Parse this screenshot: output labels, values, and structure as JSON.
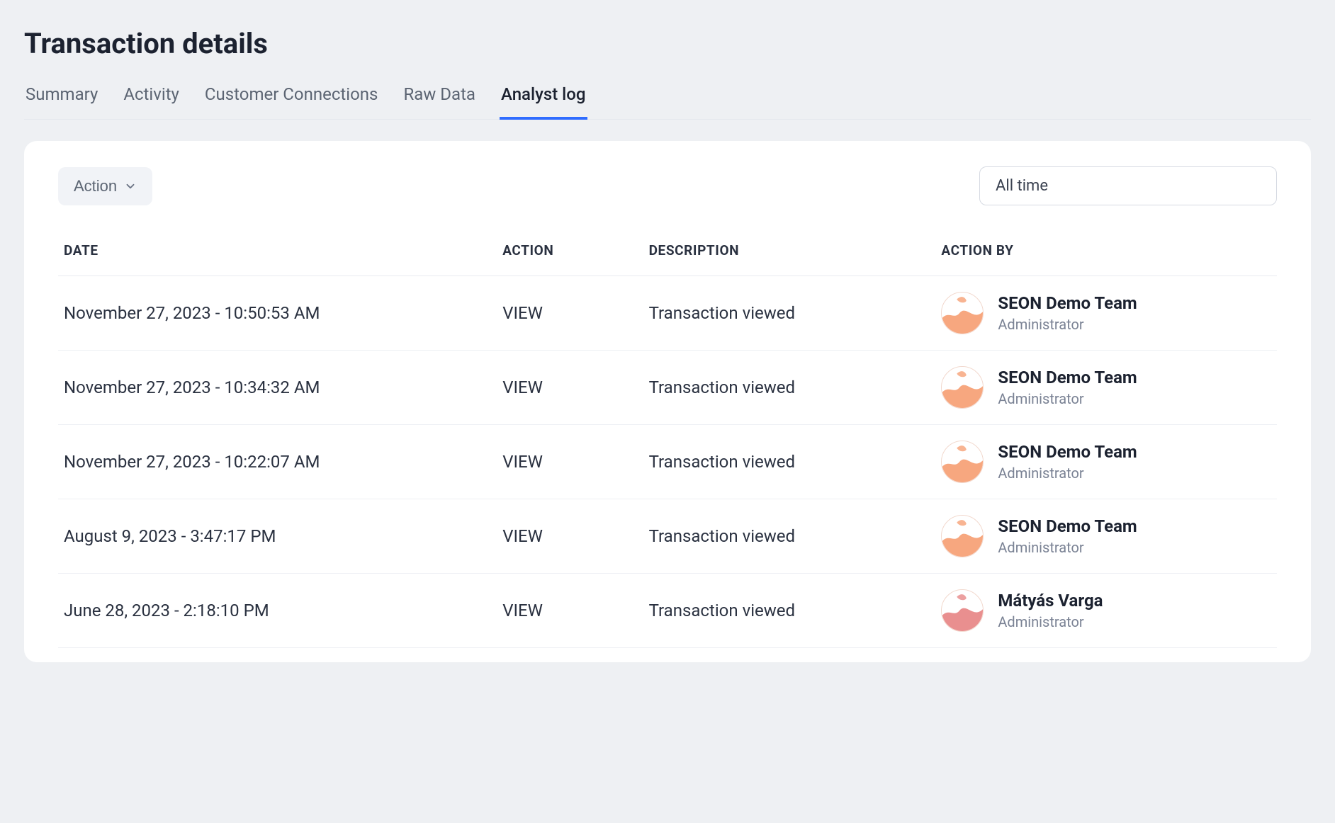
{
  "page": {
    "title": "Transaction details"
  },
  "tabs": [
    {
      "label": "Summary",
      "active": false
    },
    {
      "label": "Activity",
      "active": false
    },
    {
      "label": "Customer Connections",
      "active": false
    },
    {
      "label": "Raw Data",
      "active": false
    },
    {
      "label": "Analyst log",
      "active": true
    }
  ],
  "filters": {
    "action_label": "Action",
    "time_label": "All time"
  },
  "table": {
    "headers": {
      "date": "DATE",
      "action": "ACTION",
      "description": "DESCRIPTION",
      "action_by": "ACTION BY"
    },
    "rows": [
      {
        "date": "November 27, 2023 - 10:50:53 AM",
        "action": "VIEW",
        "description": "Transaction viewed",
        "actor": {
          "name": "SEON Demo Team",
          "role": "Administrator",
          "avatar_color": "#f7a77f"
        }
      },
      {
        "date": "November 27, 2023 - 10:34:32 AM",
        "action": "VIEW",
        "description": "Transaction viewed",
        "actor": {
          "name": "SEON Demo Team",
          "role": "Administrator",
          "avatar_color": "#f7a77f"
        }
      },
      {
        "date": "November 27, 2023 - 10:22:07 AM",
        "action": "VIEW",
        "description": "Transaction viewed",
        "actor": {
          "name": "SEON Demo Team",
          "role": "Administrator",
          "avatar_color": "#f7a77f"
        }
      },
      {
        "date": "August 9, 2023 - 3:47:17 PM",
        "action": "VIEW",
        "description": "Transaction viewed",
        "actor": {
          "name": "SEON Demo Team",
          "role": "Administrator",
          "avatar_color": "#f7a77f"
        }
      },
      {
        "date": "June 28, 2023 - 2:18:10 PM",
        "action": "VIEW",
        "description": "Transaction viewed",
        "actor": {
          "name": "Mátyás Varga",
          "role": "Administrator",
          "avatar_color": "#e98f8f"
        }
      }
    ]
  }
}
